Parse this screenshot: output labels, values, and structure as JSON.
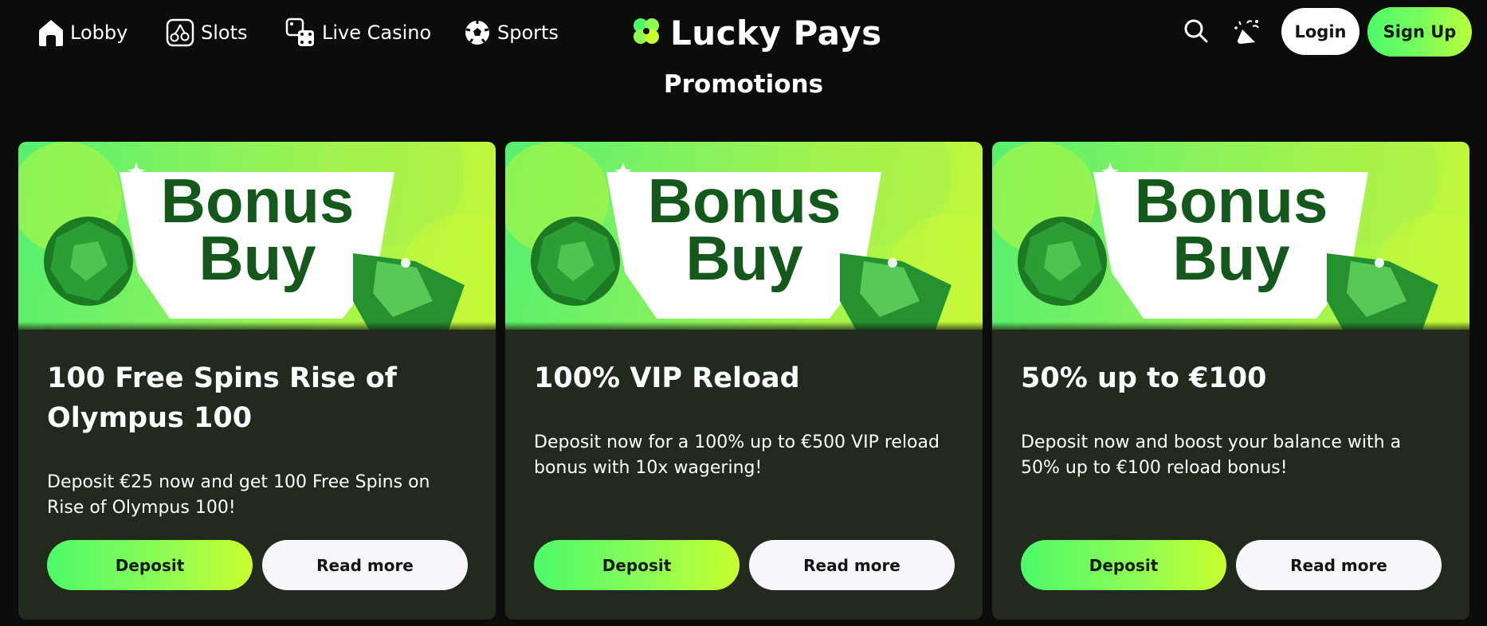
{
  "nav": {
    "items": [
      {
        "label": "Lobby",
        "icon": "home-icon"
      },
      {
        "label": "Slots",
        "icon": "cherries-icon"
      },
      {
        "label": "Live Casino",
        "icon": "dice-icon"
      },
      {
        "label": "Sports",
        "icon": "soccer-ball-icon"
      }
    ]
  },
  "brand": {
    "name": "Lucky Pays",
    "logo_icon": "clover-icon",
    "accent": "#4dfa6a",
    "accent_end": "#c8ff2e"
  },
  "header": {
    "search_icon": "search-icon",
    "promo_icon": "party-popper-icon",
    "login_label": "Login",
    "signup_label": "Sign Up"
  },
  "page": {
    "title": "Promotions"
  },
  "promotions": [
    {
      "banner_text_line1": "Bonus",
      "banner_text_line2": "Buy",
      "title": "100 Free Spins Rise of Olympus 100",
      "description": "Deposit €25 now and get 100 Free Spins on Rise of Olympus 100!",
      "deposit_label": "Deposit",
      "readmore_label": "Read more"
    },
    {
      "banner_text_line1": "Bonus",
      "banner_text_line2": "Buy",
      "title": "100% VIP Reload",
      "description": "Deposit now for a 100% up to €500 VIP reload bonus with 10x wagering!",
      "deposit_label": "Deposit",
      "readmore_label": "Read more"
    },
    {
      "banner_text_line1": "Bonus",
      "banner_text_line2": "Buy",
      "title": "50% up to €100",
      "description": "Deposit now and boost your balance with a 50% up to €100 reload bonus!",
      "deposit_label": "Deposit",
      "readmore_label": "Read more"
    }
  ]
}
